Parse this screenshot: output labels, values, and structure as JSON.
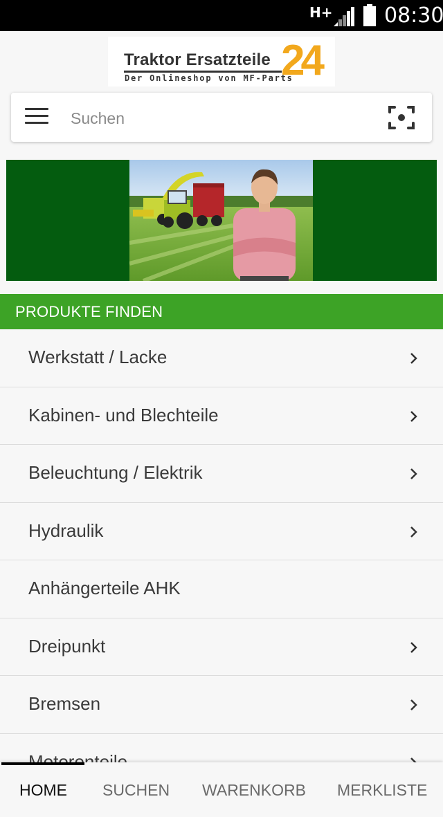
{
  "status_bar": {
    "network": "H+",
    "time": "08:30"
  },
  "logo": {
    "brand": "Traktor Ersatzteile",
    "number": "24",
    "tagline": "Der Onlineshop von MF-Parts"
  },
  "search": {
    "placeholder": "Suchen",
    "menu_icon": "hamburger-menu-icon",
    "scan_icon": "scan-icon"
  },
  "section": {
    "title": "PRODUKTE FINDEN"
  },
  "categories": [
    {
      "label": "Werkstatt / Lacke",
      "has_children": true
    },
    {
      "label": "Kabinen- und Blechteile",
      "has_children": true
    },
    {
      "label": "Beleuchtung / Elektrik",
      "has_children": true
    },
    {
      "label": "Hydraulik",
      "has_children": true
    },
    {
      "label": "Anhängerteile AHK",
      "has_children": false
    },
    {
      "label": "Dreipunkt",
      "has_children": true
    },
    {
      "label": "Bremsen",
      "has_children": true
    },
    {
      "label": "Motorenteile",
      "has_children": true
    }
  ],
  "bottom_nav": {
    "active": "HOME",
    "tabs": [
      "HOME",
      "SUCHEN",
      "WARENKORB",
      "MERKLISTE"
    ]
  },
  "colors": {
    "accent_green": "#3da326",
    "banner_green": "#045c0f",
    "logo_orange": "#f2a81d"
  }
}
